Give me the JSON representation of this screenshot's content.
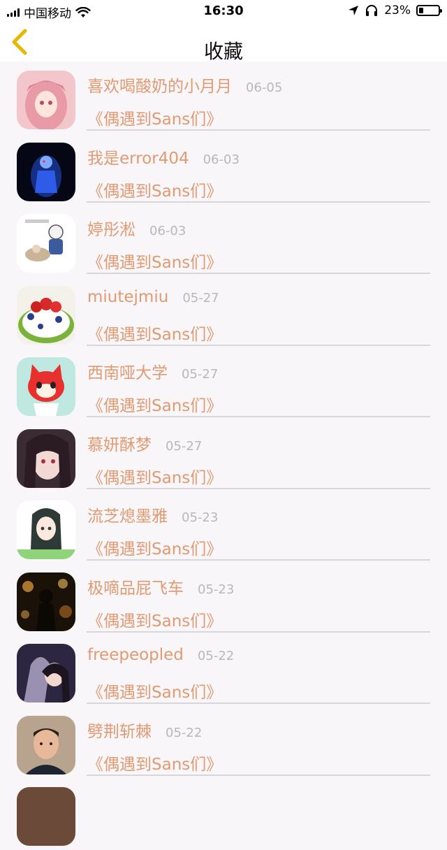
{
  "status_bar": {
    "carrier": "中国移动",
    "time": "16:30",
    "battery_percent": "23%",
    "battery_level": 0.23,
    "icons": [
      "signal-icon",
      "wifi-icon",
      "location-arrow-icon",
      "headphones-icon",
      "battery-icon"
    ]
  },
  "nav": {
    "title": "收藏",
    "back_icon": "chevron-left-icon",
    "accent_color": "#e6b800"
  },
  "colors": {
    "name": "#e19a72",
    "date": "#b8b8b8",
    "background": "#f8f6f8"
  },
  "favorites": [
    {
      "name": "喜欢喝酸奶的小月月",
      "date": "06-05",
      "book": "《偶遇到Sans们》",
      "avatar": "anime-pink-hair-avatar"
    },
    {
      "name": "我是error404",
      "date": "06-03",
      "book": "《偶遇到Sans们》",
      "avatar": "dark-blue-figure-avatar"
    },
    {
      "name": "婷彤淞",
      "date": "06-03",
      "book": "《偶遇到Sans们》",
      "avatar": "sans-comic-avatar"
    },
    {
      "name": "miutejmiu",
      "date": "05-27",
      "book": "《偶遇到Sans们》",
      "avatar": "fruit-cake-avatar"
    },
    {
      "name": "西南哑大学",
      "date": "05-27",
      "book": "《偶遇到Sans们》",
      "avatar": "red-fox-cartoon-avatar"
    },
    {
      "name": "慕妍酥梦",
      "date": "05-27",
      "book": "《偶遇到Sans们》",
      "avatar": "anime-dark-hair-avatar"
    },
    {
      "name": "流芝熄墨雅",
      "date": "05-23",
      "book": "《偶遇到Sans们》",
      "avatar": "anime-green-girl-avatar"
    },
    {
      "name": "极嘀品屁飞车",
      "date": "05-23",
      "book": "《偶遇到Sans们》",
      "avatar": "bokeh-silhouette-avatar"
    },
    {
      "name": "freepeopled",
      "date": "05-22",
      "book": "《偶遇到Sans们》",
      "avatar": "woman-portrait-avatar"
    },
    {
      "name": "劈荆斩棘",
      "date": "05-22",
      "book": "《偶遇到Sans们》",
      "avatar": "man-photo-avatar"
    }
  ]
}
